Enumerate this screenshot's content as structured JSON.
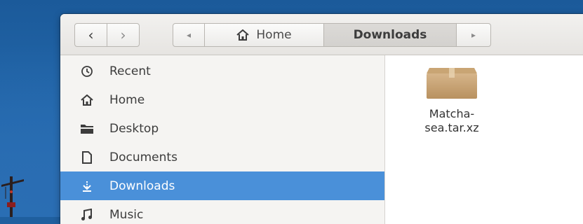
{
  "toolbar": {
    "back_glyph": "‹",
    "forward_glyph": "›",
    "path_scroll_left_glyph": "◂",
    "path_scroll_right_glyph": "▸",
    "breadcrumbs": [
      {
        "label": "Home",
        "icon": "home-icon"
      },
      {
        "label": "Downloads",
        "current": true
      }
    ]
  },
  "sidebar": {
    "items": [
      {
        "label": "Recent",
        "icon": "clock-icon"
      },
      {
        "label": "Home",
        "icon": "home-icon"
      },
      {
        "label": "Desktop",
        "icon": "folder-icon"
      },
      {
        "label": "Documents",
        "icon": "document-icon"
      },
      {
        "label": "Downloads",
        "icon": "download-icon",
        "selected": true
      },
      {
        "label": "Music",
        "icon": "music-icon"
      }
    ]
  },
  "files": [
    {
      "name_line1": "Matcha-",
      "name_line2": "sea.tar.xz",
      "icon": "package-icon"
    }
  ],
  "colors": {
    "selection": "#4a90d9",
    "desktop": "#1f5f9f"
  }
}
